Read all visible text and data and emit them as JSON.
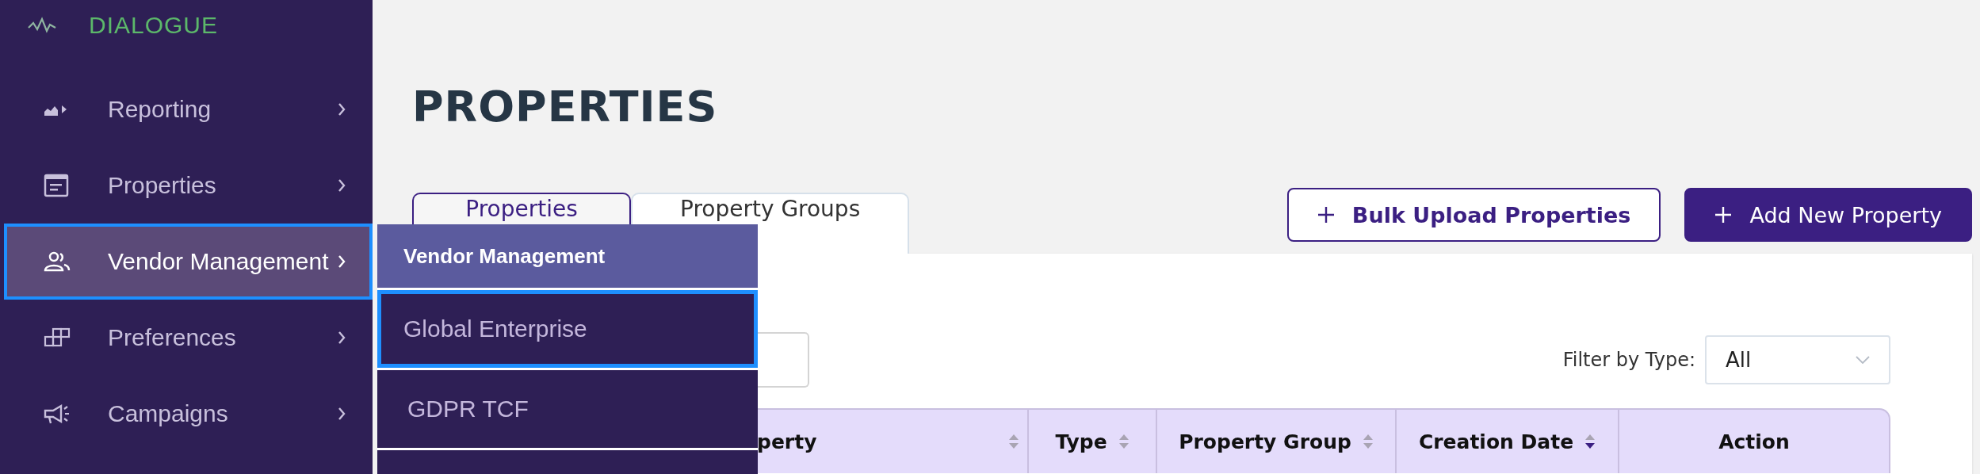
{
  "brand": {
    "name": "DIALOGUE"
  },
  "sidebar": {
    "items": [
      {
        "label": "Reporting",
        "selected": false
      },
      {
        "label": "Properties",
        "selected": false
      },
      {
        "label": "Vendor Management",
        "selected": true
      },
      {
        "label": "Preferences",
        "selected": false
      },
      {
        "label": "Campaigns",
        "selected": false
      }
    ]
  },
  "flyout": {
    "title": "Vendor Management",
    "items": [
      {
        "label": "Global Enterprise",
        "selected": true
      },
      {
        "label": "GDPR TCF",
        "selected": false
      }
    ]
  },
  "page": {
    "title": "PROPERTIES"
  },
  "tabs": [
    {
      "label": "Properties",
      "selected": true
    },
    {
      "label": "Property Groups",
      "selected": false
    }
  ],
  "buttons": [
    {
      "label": "Bulk Upload Properties",
      "kind": "outline"
    },
    {
      "label": "Add New Property",
      "kind": "primary"
    }
  ],
  "filter": {
    "label": "Filter by Type:",
    "value": "All"
  },
  "table": {
    "columns": [
      {
        "label": "perty",
        "sortable": true,
        "sorted_descending": false
      },
      {
        "label": "Type",
        "sortable": true,
        "sorted_descending": false
      },
      {
        "label": "Property Group",
        "sortable": true,
        "sorted_descending": false
      },
      {
        "label": "Creation Date",
        "sortable": true,
        "sorted_descending": true
      },
      {
        "label": "Action",
        "sortable": false
      }
    ]
  }
}
